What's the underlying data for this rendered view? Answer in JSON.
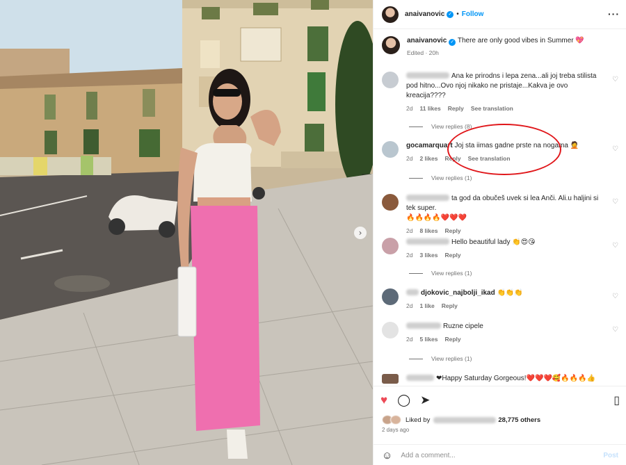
{
  "header": {
    "username": "anaivanovic",
    "follow_label": "Follow",
    "more_icon": "more-horizontal-icon",
    "separator": "•"
  },
  "caption": {
    "username": "anaivanovic",
    "text": "There are only good vibes in Summer 💖",
    "meta": "Edited · 20h"
  },
  "comments": [
    {
      "user": "",
      "text": "Ana ke prirodns i lepa zena...ali joj treba stilista pod hitno...Ovo njoj nikako ne pristaje...Kakva je ovo kreacija????",
      "age": "2d",
      "likes": "11 likes",
      "reply": "Reply",
      "translate": "See translation",
      "replies": "View replies (8)",
      "avatar_color": "#c7ccd2"
    },
    {
      "user": "gocamarquart",
      "text": "Joj sta iimas gadne prste na nogama 🤦",
      "age": "2d",
      "likes": "2 likes",
      "reply": "Reply",
      "translate": "See translation",
      "replies": "View replies (1)",
      "avatar_color": "#b9c6cf"
    },
    {
      "user": "",
      "text": "ta god da obučeš uvek si lea Anči. Ali.u haljini si tek super.",
      "emojis": "🔥🔥🔥🔥❤️❤️❤️",
      "age": "2d",
      "likes": "8 likes",
      "reply": "Reply",
      "avatar_color": "#8a5a3c"
    },
    {
      "user": "",
      "text": "Hello beautiful lady 👏😍😘",
      "age": "2d",
      "likes": "3 likes",
      "reply": "Reply",
      "replies": "View replies (1)",
      "avatar_color": "#c9a0a8"
    },
    {
      "user": "djokovic_najbolji_ikad",
      "text": "👏👏👏",
      "age": "2d",
      "likes": "1 like",
      "reply": "Reply",
      "avatar_color": "#5d6a78"
    },
    {
      "user": "",
      "text": "Ruzne cipele",
      "age": "2d",
      "likes": "5 likes",
      "reply": "Reply",
      "replies": "View replies (1)",
      "avatar_color": "#e3e3e3"
    },
    {
      "user": "",
      "text": "❤Happy Saturday Gorgeous!❤️❤️❤️🥰🔥🔥🔥👍",
      "avatar_color": "#7a5c4a"
    }
  ],
  "actions": {
    "like_icon": "heart-filled-icon",
    "comment_icon": "comment-icon",
    "share_icon": "send-icon",
    "save_icon": "bookmark-icon",
    "liked_by_prefix": "Liked by",
    "likes_count": "28,775 others",
    "time_ago": "2 days ago"
  },
  "add_comment": {
    "placeholder": "Add a comment...",
    "post_label": "Post"
  },
  "colors": {
    "accent": "#0095f6",
    "like_red": "#ed4956",
    "annotation_red": "#e0161a"
  }
}
